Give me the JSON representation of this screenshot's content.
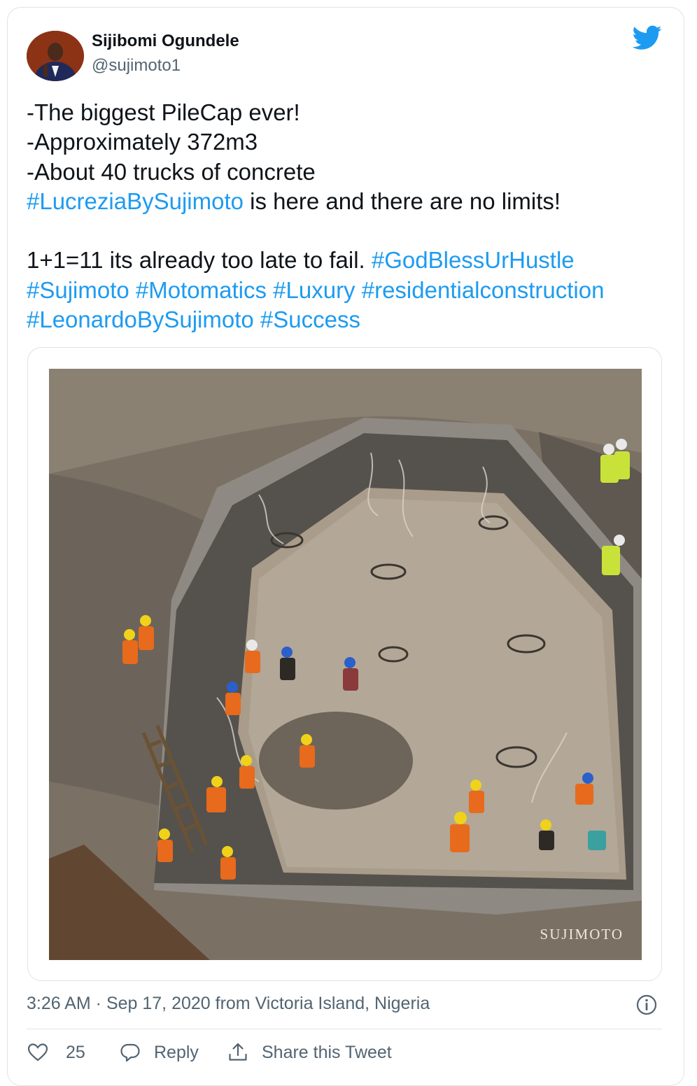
{
  "author": {
    "name": "Sijibomi Ogundele",
    "handle": "@sujimoto1"
  },
  "tweet": {
    "line1": "-The biggest PileCap ever!",
    "line2": "-Approximately 372m3",
    "line3": "-About 40 trucks of concrete",
    "hashtag1": "#LucreziaBySujimoto",
    "line4_rest": " is here and there are no limits!",
    "line5": "1+1=11 its already too late to fail. ",
    "hashtag2": "#GodBlessUrHustle",
    "hashtag3": "#Sujimoto",
    "hashtag4": "#Motomatics",
    "hashtag5": "#Luxury",
    "hashtag6": "#residentialconstruction",
    "hashtag7": "#LeonardoBySujimoto",
    "hashtag8": "#Success"
  },
  "media": {
    "watermark": "SUJIMOTO"
  },
  "meta": {
    "timestamp": "3:26 AM · Sep 17, 2020 from Victoria Island, Nigeria"
  },
  "actions": {
    "like_count": "25",
    "reply_label": "Reply",
    "share_label": "Share this Tweet"
  },
  "colors": {
    "link": "#1d9bf0",
    "text": "#0f1419",
    "secondary": "#536471",
    "border": "#dfe3e6"
  },
  "icons": [
    "twitter-bird-icon",
    "info-icon",
    "heart-icon",
    "reply-bubble-icon",
    "share-icon"
  ]
}
